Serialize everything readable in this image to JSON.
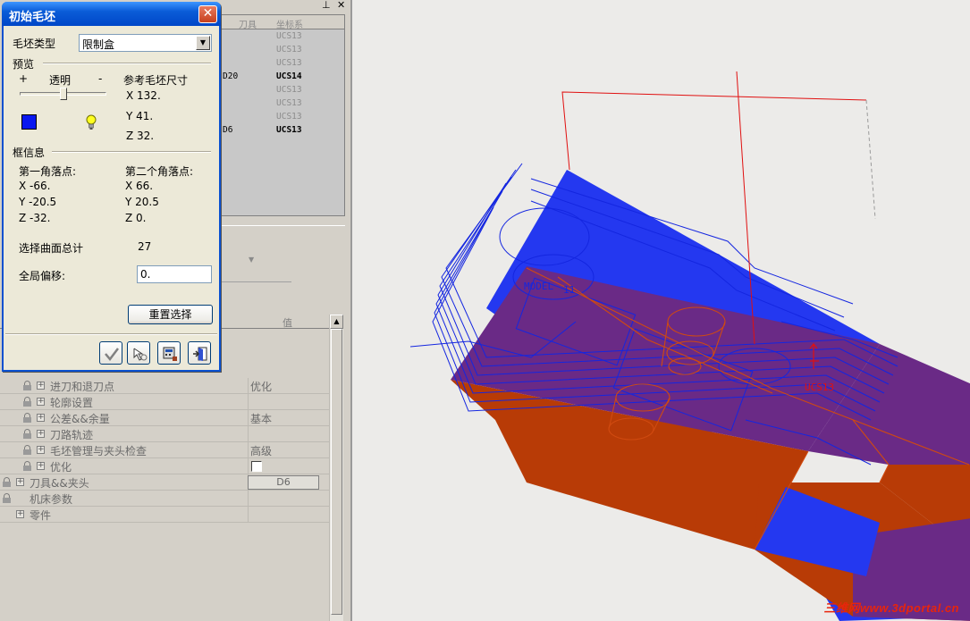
{
  "dialog": {
    "title": "初始毛坯",
    "close_glyph": "✕",
    "blank_type_label": "毛坯类型",
    "blank_type_value": "限制盒",
    "preview_label": "预览",
    "plus": "+",
    "transparency_label": "透明",
    "minus": "-",
    "ref_size_label": "参考毛坯尺寸",
    "ref_size": {
      "x": "X  132.",
      "y": "Y  41.",
      "z": "Z  32."
    },
    "box_info_label": "框信息",
    "corner1_label": "第一角落点:",
    "corner1": {
      "x": "X  -66.",
      "y": "Y  -20.5",
      "z": "Z  -32."
    },
    "corner2_label": "第二个角落点:",
    "corner2": {
      "x": "X  66.",
      "y": "Y  20.5",
      "z": "Z  0."
    },
    "surface_total_label": "选择曲面总计",
    "surface_total_value": "27",
    "global_offset_label": "全局偏移:",
    "global_offset_value": "0.",
    "reset_button": "重置选择",
    "swatch_color": "#0a18f0",
    "footer_icons": [
      "ok-check-icon",
      "pick-arrow-icon",
      "calculator-icon",
      "exit-door-icon"
    ]
  },
  "ops_list": {
    "headers": {
      "tool": "刀具",
      "cs": "坐标系"
    },
    "rows": [
      {
        "tool": "",
        "cs": "UCS13",
        "style": "dim"
      },
      {
        "tool": "",
        "cs": "UCS13",
        "style": "dim"
      },
      {
        "tool": "",
        "cs": "UCS13",
        "style": "dim"
      },
      {
        "tool": "D20",
        "cs": "UCS14",
        "style": "dark"
      },
      {
        "tool": "",
        "cs": "UCS13",
        "style": "dim"
      },
      {
        "tool": "",
        "cs": "UCS13",
        "style": "dim"
      },
      {
        "tool": "",
        "cs": "UCS13",
        "style": "dim"
      },
      {
        "tool": "D6",
        "cs": "UCS13",
        "style": "dark"
      }
    ]
  },
  "property_tree": {
    "value_header": "值",
    "rows": [
      {
        "label": "进刀和退刀点",
        "value": "优化",
        "indent": 2
      },
      {
        "label": "轮廓设置",
        "value": "",
        "indent": 2
      },
      {
        "label": "公差&&余量",
        "value": "基本",
        "indent": 2
      },
      {
        "label": "刀路轨迹",
        "value": "",
        "indent": 2
      },
      {
        "label": "毛坯管理与夹头检查",
        "value": "高级",
        "indent": 2
      },
      {
        "label": "优化",
        "value": "",
        "indent": 2,
        "checkbox": true
      },
      {
        "label": "刀具&&夹头",
        "value": "",
        "indent": 1,
        "button": "D6"
      },
      {
        "label": "机床参数",
        "value": "",
        "indent": 1,
        "nolock_plus": true
      },
      {
        "label": "零件",
        "value": "",
        "indent": 1,
        "noplus_lock": true
      }
    ]
  },
  "viewport": {
    "labels": {
      "model": "MODEL",
      "model_cs": "11",
      "ucs": "UCS13"
    },
    "watermark": "三维网www.3dportal.cn",
    "colors": {
      "stock_blue": "#2438f0",
      "part_orange": "#b83b06",
      "part_purple": "#6a2a86",
      "wire_blue": "#1426e0",
      "box_red": "#e01010"
    }
  }
}
